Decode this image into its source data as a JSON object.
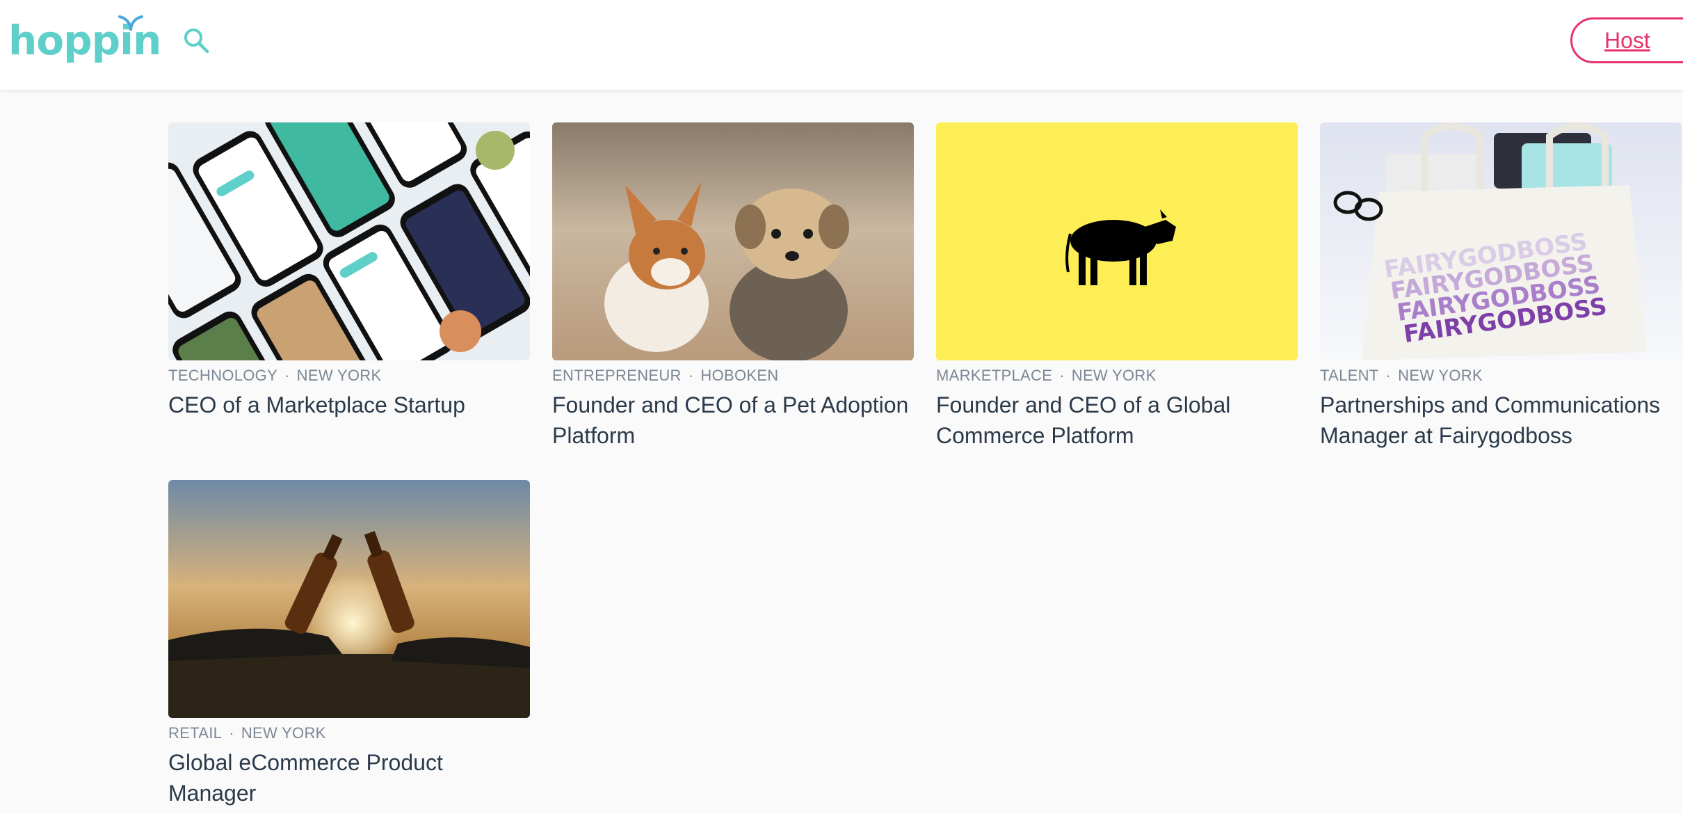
{
  "header": {
    "logo_text": "hoppin",
    "search_icon": "search-icon",
    "host_label": "Host"
  },
  "colors": {
    "brand_teal": "#5fcfc9",
    "accent_pink": "#e8336b",
    "meta_gray": "#7b8794",
    "title_text": "#2b3a4a"
  },
  "cards": [
    {
      "category": "TECHNOLOGY",
      "location": "NEW YORK",
      "title": "CEO of a Marketplace Startup"
    },
    {
      "category": "ENTREPRENEUR",
      "location": "HOBOKEN",
      "title": "Founder and CEO of a Pet Adoption Platform"
    },
    {
      "category": "MARKETPLACE",
      "location": "NEW YORK",
      "title": "Founder and CEO of a Global Commerce Platform"
    },
    {
      "category": "TALENT",
      "location": "NEW YORK",
      "title": "Partnerships and Communications Manager at Fairygodboss"
    },
    {
      "category": "RETAIL",
      "location": "NEW YORK",
      "title": "Global eCommerce Product Manager"
    }
  ],
  "image_text": {
    "tote_brand": "FAIRYGODBOSS"
  },
  "separator": "·"
}
